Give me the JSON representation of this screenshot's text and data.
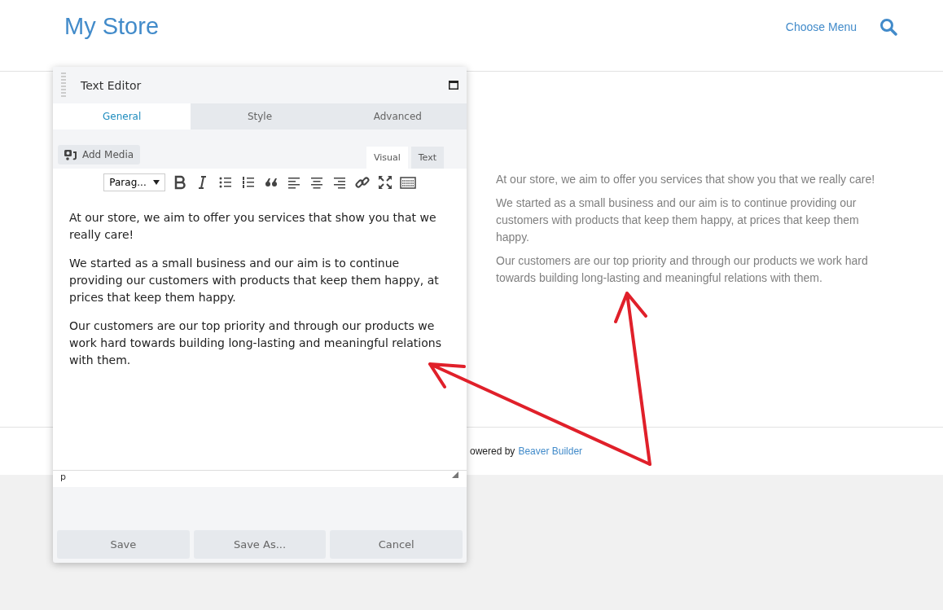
{
  "site": {
    "title": "My Store",
    "menu": "Choose Menu"
  },
  "content": {
    "paragraphs": [
      "At our store, we aim to offer you services that show you that we really care!",
      "We started as a small business and our aim is to continue providing our customers with products that keep them happy, at prices that keep them happy.",
      "Our customers are our top priority and through our products we work hard towards building long-lasting and meaningful relations with them."
    ]
  },
  "footer": {
    "text": "owered by",
    "link": "Beaver Builder"
  },
  "editor": {
    "title": "Text Editor",
    "tabs": [
      {
        "label": "General",
        "selected": true
      },
      {
        "label": "Style",
        "selected": false
      },
      {
        "label": "Advanced",
        "selected": false
      }
    ],
    "add_media": "Add Media",
    "modes": [
      {
        "label": "Visual",
        "selected": true
      },
      {
        "label": "Text",
        "selected": false
      }
    ],
    "format": "Parag...",
    "paragraphs": [
      "At our store, we aim to offer you services that show you that we really care!",
      "We started as a small business and our aim is to continue providing our customers with products that keep them happy, at prices that keep them happy.",
      "Our customers are our top priority and through our products we work hard towards building long-lasting and meaningful relations with them."
    ],
    "path": "p",
    "buttons": [
      "Save",
      "Save As...",
      "Cancel"
    ]
  }
}
